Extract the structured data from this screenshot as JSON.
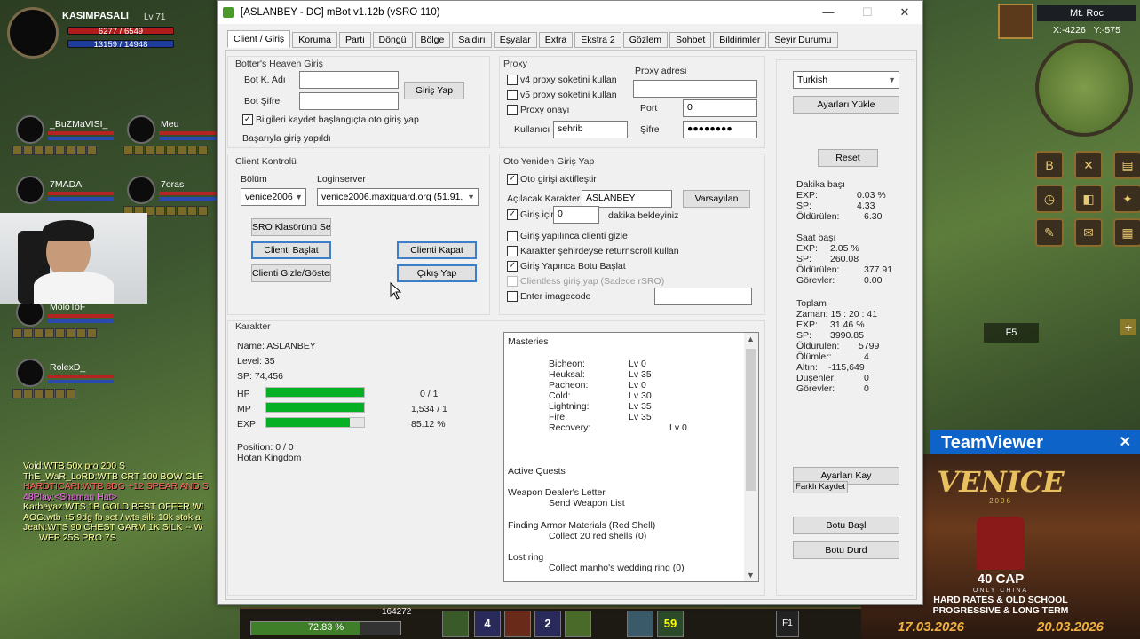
{
  "game": {
    "player": {
      "name": "KASIMPASALI",
      "level": "Lv 71",
      "hp": "6277 / 6549",
      "mp": "13159 / 14948"
    },
    "party": [
      {
        "name": "_BuZMaVISI_"
      },
      {
        "name": "Meu"
      },
      {
        "name": "7MADA"
      },
      {
        "name": "7oras"
      },
      {
        "name": "MoloToF"
      },
      {
        "name": "RolexD_"
      }
    ],
    "chat": [
      {
        "text": "Void:WTB 50x pro 200 S",
        "color": "#ffffa0"
      },
      {
        "text": "ThE_WaR_LoRD:WTB CRT 100 BOW CLE",
        "color": "#ffffa0"
      },
      {
        "text": "HARDTICARI:WTB 8DG +12 SPEAR AND S",
        "color": "#ff6060"
      },
      {
        "text": "48Play:<Shaman Hat>",
        "color": "#ff60ff"
      },
      {
        "text": "Karbeyaz:WTS 1B GOLD BEST OFFER WI",
        "color": "#ffffa0"
      },
      {
        "text": "AOG:wtb +5 9dg fb set / wts silk 10k stok a",
        "color": "#ffffa0"
      },
      {
        "text": "JeaN:WTS 90 CHEST GARM 1K SILK -- W",
        "color": "#ffffa0"
      },
      {
        "text": "WEP 25S PRO 7S",
        "color": "#ffffa0"
      }
    ],
    "minimap": {
      "area": "Mt. Roc",
      "x": "X:-4226",
      "y": "Y:-575"
    },
    "hotbar_label": "F5",
    "exp_percent": "72.83 %",
    "bottom_count": "164272",
    "slot_numbers": [
      "4",
      "2",
      "59"
    ],
    "f_key": "F1"
  },
  "teamviewer": {
    "title": "TeamViewer",
    "close": "✕"
  },
  "ad": {
    "logo": "VENICE",
    "sub": "2006",
    "cap": "40 CAP",
    "only": "ONLY CHINA",
    "line1": "HARD RATES & OLD SCHOOL",
    "line2": "PROGRESSIVE & LONG TERM",
    "date1": "17.03.2026",
    "date2": "20.03.2026"
  },
  "window": {
    "title": "[ASLANBEY - DC] mBot v1.12b (vSRO 110)",
    "tabs": [
      "Client / Giriş",
      "Koruma",
      "Parti",
      "Döngü",
      "Bölge",
      "Saldırı",
      "Eşyalar",
      "Extra",
      "Ekstra 2",
      "Gözlem",
      "Sohbet",
      "Bildirimler",
      "Seyir Durumu"
    ],
    "botters": {
      "group": "Botter's Heaven Giriş",
      "user_label": "Bot K. Adı",
      "pass_label": "Bot Şifre",
      "login_btn": "Giriş Yap",
      "remember": "Bilgileri kaydet başlangıçta oto giriş yap",
      "status": "Başarıyla giriş yapıldı"
    },
    "client": {
      "group": "Client Kontrolü",
      "section_label": "Bölüm",
      "login_label": "Loginserver",
      "section_value": "venice2006",
      "login_value": "venice2006.maxiguard.org (51.91.",
      "sro_btn": "SRO Klasörünü Seç",
      "start_btn": "Clienti Başlat",
      "close_btn": "Clienti Kapat",
      "hide_btn": "Clienti Gizle/Göster",
      "exit_btn": "Çıkış Yap"
    },
    "proxy": {
      "group": "Proxy",
      "v4": "v4 proxy soketini kullan",
      "v5": "v5 proxy soketini kullan",
      "confirm": "Proxy onayı",
      "addr_label": "Proxy adresi",
      "port_label": "Port",
      "port_value": "0",
      "user_label": "Kullanıcı",
      "user_value": "sehrib",
      "pass_label": "Şifre",
      "pass_value": "●●●●●●●●"
    },
    "relogin": {
      "group": "Oto Yeniden Giriş Yap",
      "auto": "Oto girişi aktifleştir",
      "char_label": "Açılacak Karakter",
      "char_value": "ASLANBEY",
      "defaults_btn": "Varsayılan",
      "wait_pre": "Giriş için",
      "wait_value": "0",
      "wait_post": "dakika bekleyiniz",
      "hide": "Giriş yapılınca clienti gizle",
      "return": "Karakter şehirdeyse returnscroll kullan",
      "startbot": "Giriş Yapınca Botu Başlat",
      "clientless": "Clientless giriş yap (Sadece rSRO)",
      "imagecode": "Enter imagecode"
    },
    "right": {
      "lang": "Turkish",
      "load_btn": "Ayarları Yükle",
      "reset_btn": "Reset",
      "per_min_title": "Dakika başı",
      "per_min": [
        [
          "EXP:",
          "0.03 %"
        ],
        [
          "SP:",
          "4.33"
        ],
        [
          "Öldürülen:",
          "6.30"
        ]
      ],
      "per_hour_title": "Saat başı",
      "per_hour": [
        [
          "EXP:",
          "2.05 %"
        ],
        [
          "SP:",
          "260.08"
        ],
        [
          "Öldürülen:",
          "377.91"
        ],
        [
          "Görevler:",
          "0.00"
        ]
      ],
      "total_title": "Toplam",
      "total": [
        [
          "Zaman: 15 : 20 : 41",
          ""
        ],
        [
          "EXP:",
          "31.46 %"
        ],
        [
          "SP:",
          "3990.85"
        ],
        [
          "Öldürülen:",
          "5799"
        ],
        [
          "Ölümler:",
          "4"
        ],
        [
          "Altın:",
          "-115,649"
        ],
        [
          "Düşenler:",
          "0"
        ],
        [
          "Görevler:",
          "0"
        ]
      ],
      "save_btn": "Ayarları Kay",
      "saveas_btn": "Farklı Kaydet",
      "start_btn": "Botu Başl",
      "stop_btn": "Botu Durd"
    },
    "character": {
      "group": "Karakter",
      "name": "Name: ASLANBEY",
      "level": "Level: 35",
      "sp": "SP: 74,456",
      "hp_label": "HP",
      "mp_label": "MP",
      "exp_label": "EXP",
      "hp_value": "0 / 1",
      "mp_value": "1,534 / 1",
      "exp_value": "85.12 %",
      "hp_fill": 1.0,
      "mp_fill": 1.0,
      "exp_fill": 0.8512,
      "position": "Position: 0 / 0",
      "kingdom": "Hotan Kingdom"
    },
    "info": {
      "masteries_title": "Masteries",
      "masteries": [
        [
          "Bicheon:",
          "Lv 0"
        ],
        [
          "Heuksal:",
          "Lv 35"
        ],
        [
          "Pacheon:",
          "Lv 0"
        ],
        [
          "Cold:",
          "Lv 30"
        ],
        [
          "Lightning:",
          "Lv 35"
        ],
        [
          "Fire:",
          "Lv 35"
        ],
        [
          "Recovery:",
          "Lv 0"
        ]
      ],
      "quests_title": "Active Quests",
      "quests": [
        {
          "name": "Weapon Dealer's Letter",
          "task": "Send Weapon List"
        },
        {
          "name": "Finding Armor Materials (Red Shell)",
          "task": "Collect 20 red shells (0)"
        },
        {
          "name": "Lost ring",
          "task": "Collect manho's wedding ring (0)"
        }
      ]
    }
  }
}
